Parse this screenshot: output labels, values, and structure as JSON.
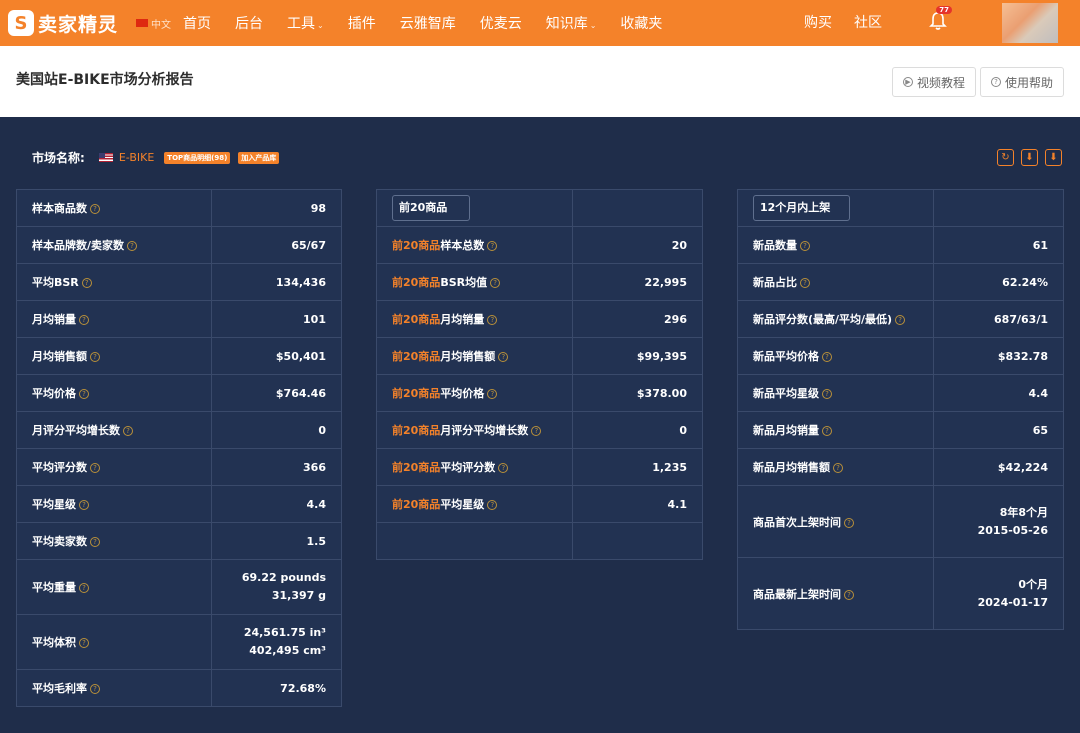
{
  "nav": {
    "logo_glyph": "S",
    "logo_text": "卖家精灵",
    "lang": "中文",
    "items": [
      {
        "label": "首页",
        "dropdown": false
      },
      {
        "label": "后台",
        "dropdown": false
      },
      {
        "label": "工具",
        "dropdown": true
      },
      {
        "label": "插件",
        "dropdown": false
      },
      {
        "label": "云雅智库",
        "dropdown": false
      },
      {
        "label": "优麦云",
        "dropdown": false
      },
      {
        "label": "知识库",
        "dropdown": true
      },
      {
        "label": "收藏夹",
        "dropdown": false
      }
    ],
    "buy": "购买",
    "community": "社区",
    "bell_badge": "77"
  },
  "header": {
    "title": "美国站E-BIKE市场分析报告",
    "video_btn": "视频教程",
    "help_btn": "使用帮助"
  },
  "market": {
    "label": "市场名称:",
    "name": "E-BIKE",
    "tag1": "TOP商品明细(98)",
    "tag2": "加入产品库"
  },
  "table1": [
    {
      "k": "样本商品数",
      "v": "98"
    },
    {
      "k": "样本品牌数/卖家数",
      "v": "65/67"
    },
    {
      "k": "平均BSR",
      "v": "134,436"
    },
    {
      "k": "月均销量",
      "v": "101"
    },
    {
      "k": "月均销售额",
      "v": "$50,401"
    },
    {
      "k": "平均价格",
      "v": "$764.46"
    },
    {
      "k": "月评分平均增长数",
      "v": "0"
    },
    {
      "k": "平均评分数",
      "v": "366"
    },
    {
      "k": "平均星级",
      "v": "4.4"
    },
    {
      "k": "平均卖家数",
      "v": "1.5"
    },
    {
      "k": "平均重量",
      "v": "69.22 pounds",
      "v2": "31,397 g"
    },
    {
      "k": "平均体积",
      "v": "24,561.75 in³",
      "v2": "402,495 cm³"
    },
    {
      "k": "平均毛利率",
      "v": "72.68%"
    }
  ],
  "table2": {
    "header": "前20商品",
    "prefix": "前20商品",
    "rows": [
      {
        "k": "样本总数",
        "v": "20"
      },
      {
        "k": "BSR均值",
        "v": "22,995"
      },
      {
        "k": "月均销量",
        "v": "296"
      },
      {
        "k": "月均销售额",
        "v": "$99,395"
      },
      {
        "k": "平均价格",
        "v": "$378.00"
      },
      {
        "k": "月评分平均增长数",
        "v": "0"
      },
      {
        "k": "平均评分数",
        "v": "1,235"
      },
      {
        "k": "平均星级",
        "v": "4.1"
      }
    ]
  },
  "table3": {
    "header": "12个月内上架",
    "rows": [
      {
        "k": "新品数量",
        "v": "61"
      },
      {
        "k": "新品占比",
        "v": "62.24%"
      },
      {
        "k": "新品评分数(最高/平均/最低)",
        "v": "687/63/1"
      },
      {
        "k": "新品平均价格",
        "v": "$832.78"
      },
      {
        "k": "新品平均星级",
        "v": "4.4"
      },
      {
        "k": "新品月均销量",
        "v": "65"
      },
      {
        "k": "新品月均销售额",
        "v": "$42,224"
      },
      {
        "k": "商品首次上架时间",
        "v": "8年8个月",
        "v2": "2015-05-26"
      },
      {
        "k": "商品最新上架时间",
        "v": "0个月",
        "v2": "2024-01-17"
      }
    ]
  }
}
